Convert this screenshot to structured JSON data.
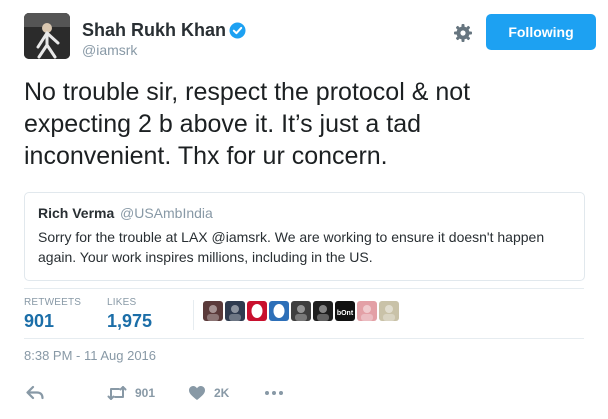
{
  "tweet": {
    "author": {
      "name": "Shah Rukh Khan",
      "handle": "@iamsrk",
      "verified": true
    },
    "follow_button": "Following",
    "text": "No trouble sir, respect the protocol & not\nexpecting 2 b above it. It’s just a tad\ninconvenient. Thx for ur concern.",
    "quoted": {
      "name": "Rich Verma",
      "handle": "@USAmbIndia",
      "text": "Sorry for the trouble at LAX @iamsrk. We are working to ensure it doesn't happen again. Your work inspires millions, including in the US."
    },
    "stats": {
      "retweets_label": "RETWEETS",
      "retweets": "901",
      "likes_label": "LIKES",
      "likes": "1,975"
    },
    "liker_avatars": [
      {
        "color": "#5b3a3a"
      },
      {
        "color": "#2f3b4f"
      },
      {
        "color": "#c8102e"
      },
      {
        "color": "#2d6fb8"
      },
      {
        "color": "#3f3f3f"
      },
      {
        "color": "#1e1e1e"
      },
      {
        "color": "#111111",
        "text": "bOnt"
      },
      {
        "color": "#e3a0a6"
      },
      {
        "color": "#c9c2a8"
      }
    ],
    "timestamp": "8:38 PM - 11 Aug 2016",
    "actions": {
      "retweet_count": "901",
      "like_count": "2K"
    },
    "colors": {
      "accent": "#1da1f2",
      "stat_value": "#1b6ea8",
      "muted": "#8899a6"
    }
  }
}
